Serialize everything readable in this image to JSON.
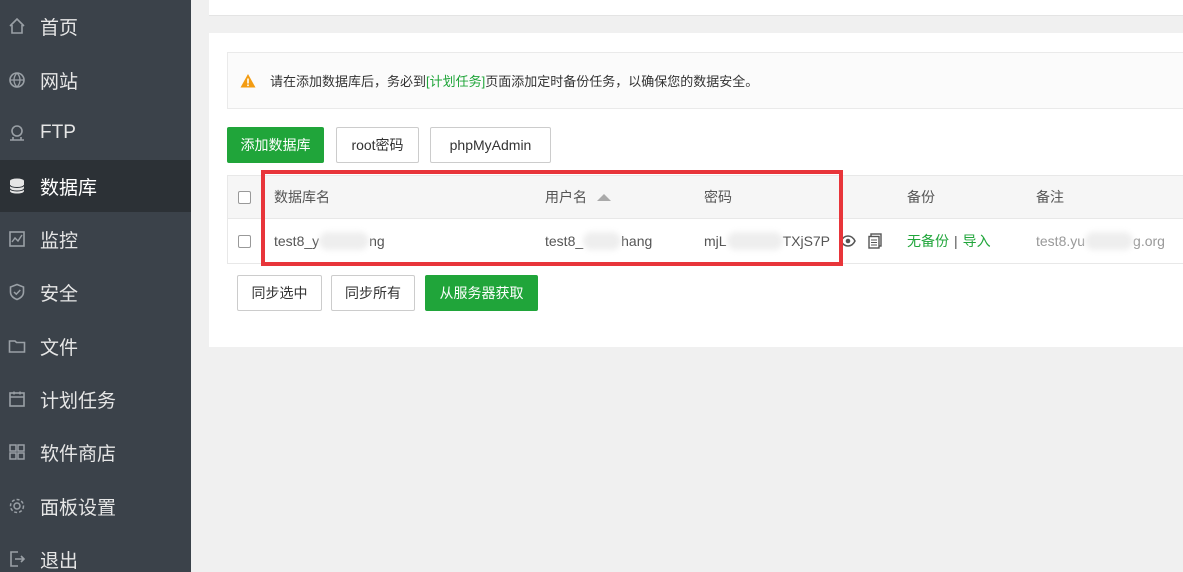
{
  "sidebar": {
    "items": [
      {
        "label": "首页",
        "icon": "home-icon"
      },
      {
        "label": "网站",
        "icon": "globe-icon"
      },
      {
        "label": "FTP",
        "icon": "ftp-icon"
      },
      {
        "label": "数据库",
        "icon": "database-icon",
        "active": true
      },
      {
        "label": "监控",
        "icon": "monitor-icon"
      },
      {
        "label": "安全",
        "icon": "shield-icon"
      },
      {
        "label": "文件",
        "icon": "folder-icon"
      },
      {
        "label": "计划任务",
        "icon": "calendar-icon"
      },
      {
        "label": "软件商店",
        "icon": "grid-icon"
      },
      {
        "label": "面板设置",
        "icon": "gear-icon"
      },
      {
        "label": "退出",
        "icon": "logout-icon"
      }
    ]
  },
  "alert": {
    "prefix": "请在添加数据库后，务必到",
    "link": "[计划任务]",
    "suffix": "页面添加定时备份任务，以确保您的数据安全。"
  },
  "toolbar": {
    "add_db": "添加数据库",
    "root_pwd": "root密码",
    "phpmyadmin": "phpMyAdmin"
  },
  "table": {
    "headers": {
      "name": "数据库名",
      "user": "用户名",
      "password": "密码",
      "backup": "备份",
      "note": "备注"
    },
    "rows": [
      {
        "name_start": "test8_y",
        "name_end": "ng",
        "user_start": "test8_",
        "user_end": "hang",
        "pwd_start": "mjL",
        "pwd_end": "TXjS7P",
        "backup_status": "无备份",
        "separator": "|",
        "import": "导入",
        "note_start": "test8.yu",
        "note_end": "g.org"
      }
    ]
  },
  "bottom_buttons": {
    "sync_selected": "同步选中",
    "sync_all": "同步所有",
    "fetch_server": "从服务器获取"
  },
  "colors": {
    "sidebar_bg": "#3b424a",
    "accent": "#20a53a",
    "highlight": "#e8353a"
  }
}
